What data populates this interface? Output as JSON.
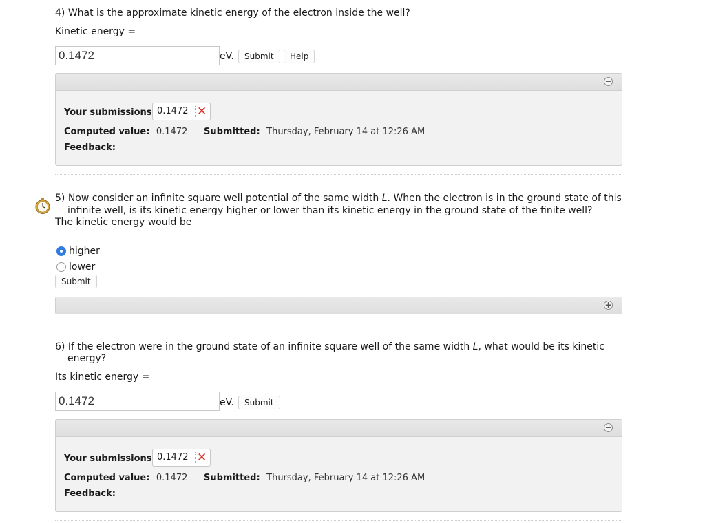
{
  "q4": {
    "question": "4) What is the approximate kinetic energy of the electron inside the well?",
    "prompt": "Kinetic energy =",
    "input_value": "0.1472",
    "unit": "eV.",
    "submit_label": "Submit",
    "help_label": "Help",
    "panel": {
      "toggle_symbol": "−",
      "submissions_label": "Your submissions:",
      "submission_value": "0.1472",
      "submission_mark": "✕",
      "computed_label": "Computed value:",
      "computed_value": "0.1472",
      "submitted_label": "Submitted:",
      "submitted_value": "Thursday, February 14 at 12:26 AM",
      "feedback_label": "Feedback:"
    }
  },
  "q5": {
    "question_line1_pre": "5) Now consider an infinite square well potential of the same width ",
    "question_line1_var": "L",
    "question_line1_post": ". When the electron is in the ground state of this",
    "question_line2": "infinite well, is its kinetic energy higher or lower than its kinetic energy in the ground state of the finite well?",
    "prompt": "The kinetic energy would be",
    "options": [
      {
        "label": "higher",
        "selected": true
      },
      {
        "label": "lower",
        "selected": false
      }
    ],
    "submit_label": "Submit",
    "panel": {
      "toggle_symbol": "+"
    }
  },
  "q6": {
    "question_line1_pre": "6) If the electron were in the ground state of an infinite square well of the same width ",
    "question_line1_var": "L",
    "question_line1_post": ", what would be its kinetic",
    "question_line2": "energy?",
    "prompt": "Its kinetic energy =",
    "input_value": "0.1472",
    "unit": "eV.",
    "submit_label": "Submit",
    "panel": {
      "toggle_symbol": "−",
      "submissions_label": "Your submissions:",
      "submission_value": "0.1472",
      "submission_mark": "✕",
      "computed_label": "Computed value:",
      "computed_value": "0.1472",
      "submitted_label": "Submitted:",
      "submitted_value": "Thursday, February 14 at 12:26 AM",
      "feedback_label": "Feedback:"
    }
  },
  "colors": {
    "radio_selected": "#2f7de1",
    "incorrect_mark": "#d9362b",
    "panel_background": "#f2f2f2"
  },
  "icons": {
    "timer": "stopwatch-icon",
    "collapse": "minus-circle-icon",
    "expand": "plus-circle-icon",
    "incorrect": "x-mark-icon"
  }
}
